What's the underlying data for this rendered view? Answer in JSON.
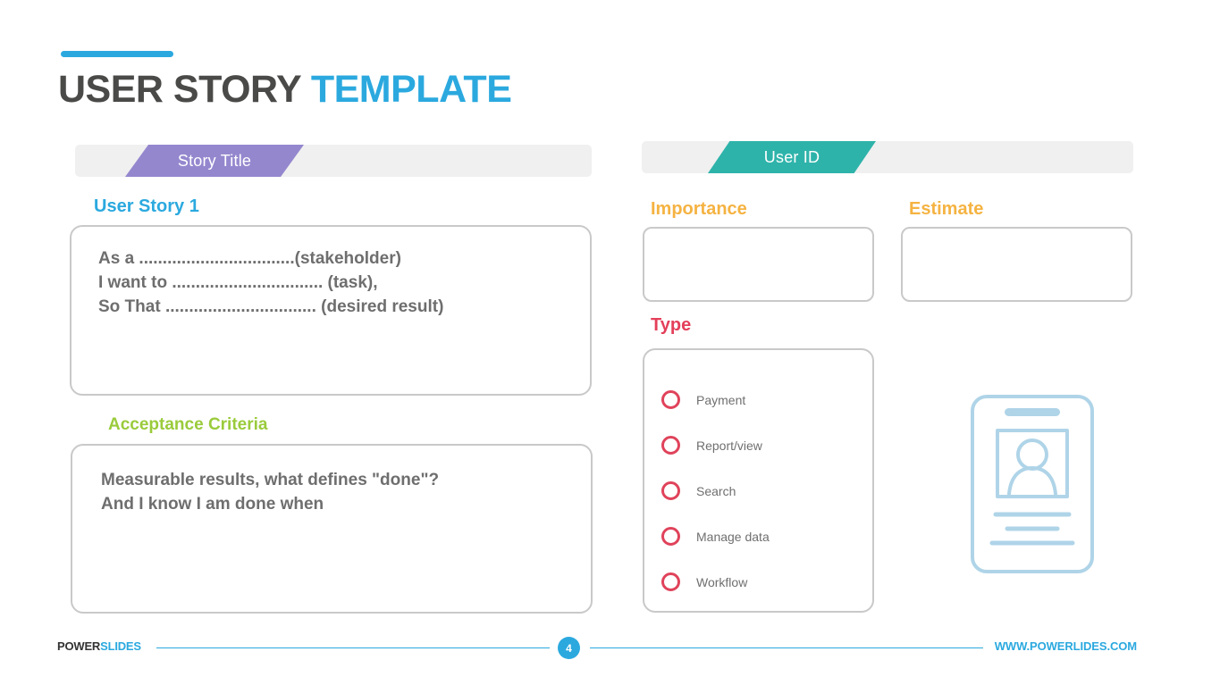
{
  "header": {
    "title_dark": "USER STORY",
    "title_accent": "TEMPLATE",
    "accent_color": "#2BA9DF"
  },
  "left_panel": {
    "banner_tag": "Story Title",
    "banner_tag_color": "#9587CE",
    "story_label": "User Story 1",
    "story_label_color": "#2BA9DF",
    "story_text": "As a .................................(stakeholder)\nI want to ................................ (task),\nSo That ................................ (desired result)",
    "acceptance_label": "Acceptance Criteria",
    "acceptance_label_color": "#9ACB3B",
    "acceptance_text": "Measurable results, what defines \"done\"?\nAnd I know I am done  when"
  },
  "right_panel": {
    "banner_tag": "User ID",
    "banner_tag_color": "#2EB3AA",
    "importance_label": "Importance",
    "importance_value": "",
    "estimate_label": "Estimate",
    "estimate_value": "",
    "field_label_color": "#F5B342",
    "type_label": "Type",
    "type_label_color": "#E4405A",
    "radio_color": "#E0435B",
    "type_options": [
      {
        "label": "Payment",
        "selected": false
      },
      {
        "label": "Report/view",
        "selected": false
      },
      {
        "label": "Search",
        "selected": false
      },
      {
        "label": "Manage data",
        "selected": false
      },
      {
        "label": "Workflow",
        "selected": false
      }
    ],
    "illustration": "id-badge-icon",
    "illustration_color": "#AFD4E8"
  },
  "footer": {
    "brand_dark": "POWER",
    "brand_accent": "SLIDES",
    "page_number": "4",
    "url": "WWW.POWERLIDES.COM",
    "rule_color": "#2BA9DF"
  }
}
